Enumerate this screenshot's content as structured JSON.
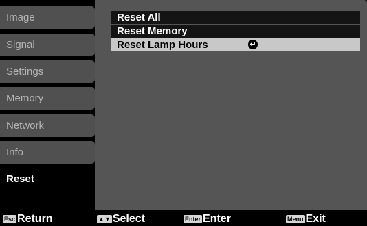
{
  "sidebar": {
    "items": [
      {
        "label": "Image"
      },
      {
        "label": "Signal"
      },
      {
        "label": "Settings"
      },
      {
        "label": "Memory"
      },
      {
        "label": "Network"
      },
      {
        "label": "Info"
      },
      {
        "label": "Reset",
        "active": true
      }
    ]
  },
  "panel": {
    "items": [
      {
        "label": "Reset All"
      },
      {
        "label": "Reset Memory"
      },
      {
        "label": "Reset Lamp Hours",
        "selected": true,
        "icon": "enter-icon"
      }
    ]
  },
  "footer": {
    "hints": [
      {
        "key": "Esc",
        "label": "Return"
      },
      {
        "key": "▲▼",
        "label": "Select"
      },
      {
        "key": "Enter",
        "label": "Enter"
      },
      {
        "key": "Menu",
        "label": "Exit"
      }
    ]
  },
  "colors": {
    "panel_bg": "#555555",
    "tab_bg": "#505050",
    "selected_row": "#c8c8c8",
    "dark_row": "#141414"
  }
}
